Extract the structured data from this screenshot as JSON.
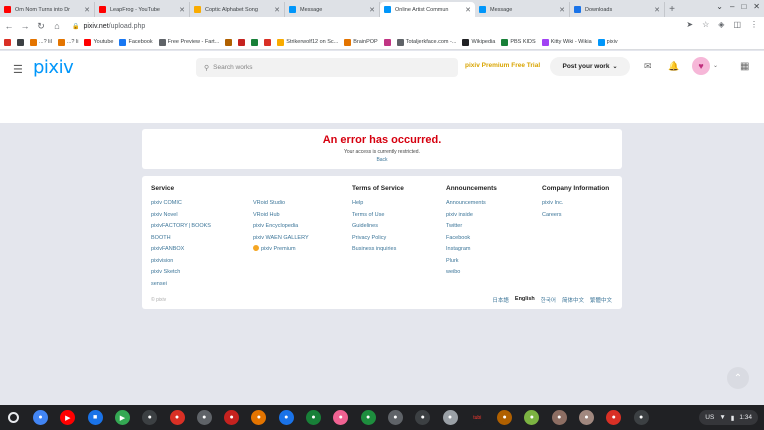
{
  "browser": {
    "tabs": [
      {
        "title": "Om Nom Turns into Dr",
        "color": "#ff0000",
        "active": false
      },
      {
        "title": "LeapFrog - YouTube",
        "color": "#ff0000",
        "active": false
      },
      {
        "title": "Coptic Alphabet Song",
        "color": "#f9ab00",
        "active": false
      },
      {
        "title": "Message",
        "color": "#0096fa",
        "active": false
      },
      {
        "title": "Online Artist Commun",
        "color": "#0096fa",
        "active": true
      },
      {
        "title": "Message",
        "color": "#0096fa",
        "active": false
      },
      {
        "title": "Downloads",
        "color": "#1a73e8",
        "active": false
      }
    ],
    "url_host": "pixiv.net",
    "url_path": "/upload.php",
    "bookmarks": [
      {
        "label": "",
        "color": "#d93025"
      },
      {
        "label": "",
        "color": "#3c4043"
      },
      {
        "label": "...? lil",
        "color": "#e37400"
      },
      {
        "label": "...? li",
        "color": "#e37400"
      },
      {
        "label": "Youtube",
        "color": "#ff0000"
      },
      {
        "label": "Facebook",
        "color": "#1877f2"
      },
      {
        "label": "Free Preview - Fart...",
        "color": "#5f6368"
      },
      {
        "label": "",
        "color": "#b06000"
      },
      {
        "label": "",
        "color": "#c5221f"
      },
      {
        "label": "",
        "color": "#188038"
      },
      {
        "label": "",
        "color": "#d93025"
      },
      {
        "label": "Strikerwolf12 on Sc...",
        "color": "#f9ab00"
      },
      {
        "label": "BrainPOP",
        "color": "#e37400"
      },
      {
        "label": "",
        "color": "#c13584"
      },
      {
        "label": "Totaljerkface.com -...",
        "color": "#5f6368"
      },
      {
        "label": "Wikipedia",
        "color": "#202124"
      },
      {
        "label": "PBS KIDS",
        "color": "#188038"
      },
      {
        "label": "Kitty Wiki - Wikia",
        "color": "#a142f4"
      },
      {
        "label": "pixiv",
        "color": "#0096fa"
      }
    ]
  },
  "header": {
    "logo": "pixiv",
    "search_placeholder": "Search works",
    "premium_label": "pixiv Premium Free Trial",
    "post_label": "Post your work"
  },
  "error": {
    "title": "An error has occurred.",
    "message": "Your access is currently restricted.",
    "back_label": "Back"
  },
  "footer": {
    "service_heading": "Service",
    "service_links": [
      "pixiv COMIC",
      "pixiv Novel",
      "pixivFACTORY | BOOKS",
      "BOOTH",
      "pixivFANBOX",
      "pixivision",
      "pixiv Sketch",
      "sensei"
    ],
    "service_links_2": [
      "VRoid Studio",
      "VRoid Hub",
      "pixiv Encyclopedia",
      "pixiv WAEN GALLERY",
      "pixiv Premium"
    ],
    "terms_heading": "Terms of Service",
    "terms_links": [
      "Help",
      "Terms of Use",
      "Guidelines",
      "Privacy Policy",
      "Business inquiries"
    ],
    "announcements_heading": "Announcements",
    "announcements_links": [
      "Announcements",
      "pixiv inside",
      "Twitter",
      "Facebook",
      "Instagram",
      "Plurk",
      "weibo"
    ],
    "company_heading": "Company Information",
    "company_links": [
      "pixiv Inc.",
      "Careers"
    ],
    "copyright": "© pixiv",
    "languages": [
      "日本語",
      "English",
      "한국어",
      "简体中文",
      "繁體中文"
    ],
    "current_language": "English"
  },
  "shelf": {
    "apps": [
      {
        "name": "chrome",
        "color": "#4285f4",
        "glyph": "●"
      },
      {
        "name": "youtube",
        "color": "#ff0000",
        "glyph": "▶"
      },
      {
        "name": "files",
        "color": "#1a73e8",
        "glyph": "■"
      },
      {
        "name": "play-store",
        "color": "#34a853",
        "glyph": "▶"
      },
      {
        "name": "app-5",
        "color": "#3c4043",
        "glyph": "●"
      },
      {
        "name": "app-6",
        "color": "#d93025",
        "glyph": "●"
      },
      {
        "name": "app-7",
        "color": "#5f6368",
        "glyph": "●"
      },
      {
        "name": "app-8",
        "color": "#c5221f",
        "glyph": "●"
      },
      {
        "name": "app-9",
        "color": "#e37400",
        "glyph": "●"
      },
      {
        "name": "app-10",
        "color": "#1a73e8",
        "glyph": "●"
      },
      {
        "name": "app-11",
        "color": "#188038",
        "glyph": "●"
      },
      {
        "name": "app-12",
        "color": "#f06292",
        "glyph": "●"
      },
      {
        "name": "app-13",
        "color": "#1e8e3e",
        "glyph": "●"
      },
      {
        "name": "app-14",
        "color": "#5f6368",
        "glyph": "●"
      },
      {
        "name": "app-15",
        "color": "#3c4043",
        "glyph": "●"
      },
      {
        "name": "app-16",
        "color": "#9aa0a6",
        "glyph": "●"
      },
      {
        "name": "tubi",
        "color": "#202124",
        "glyph": "tubi"
      },
      {
        "name": "app-18",
        "color": "#b06000",
        "glyph": "●"
      },
      {
        "name": "app-19",
        "color": "#7cb342",
        "glyph": "●"
      },
      {
        "name": "app-20",
        "color": "#8d6e63",
        "glyph": "●"
      },
      {
        "name": "app-21",
        "color": "#a1887f",
        "glyph": "●"
      },
      {
        "name": "app-22",
        "color": "#d93025",
        "glyph": "●"
      },
      {
        "name": "app-23",
        "color": "#3c4043",
        "glyph": "●"
      }
    ],
    "status_locale": "US",
    "time": "1:34"
  }
}
